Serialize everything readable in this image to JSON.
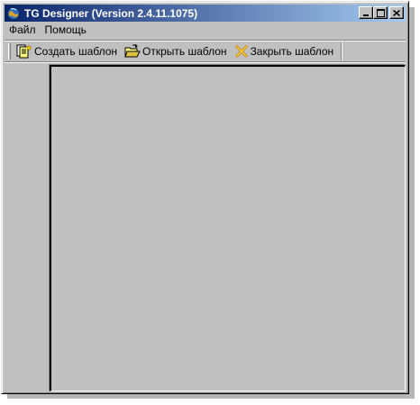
{
  "window": {
    "title": "TG Designer (Version 2.4.11.1075)",
    "icon": "app-globe-icon"
  },
  "caption_buttons": {
    "minimize": "_",
    "maximize": "□",
    "close": "✕"
  },
  "menu": {
    "items": [
      {
        "label": "Файл"
      },
      {
        "label": "Помощь"
      }
    ]
  },
  "toolbar": {
    "buttons": [
      {
        "label": "Создать шаблон",
        "icon": "new-template-icon"
      },
      {
        "label": "Открыть шаблон",
        "icon": "open-folder-icon"
      },
      {
        "label": "Закрыть шаблон",
        "icon": "close-template-icon"
      }
    ]
  },
  "colors": {
    "titlebar_start": "#0a246a",
    "titlebar_end": "#a6caf0",
    "face": "#c0c0c0"
  }
}
